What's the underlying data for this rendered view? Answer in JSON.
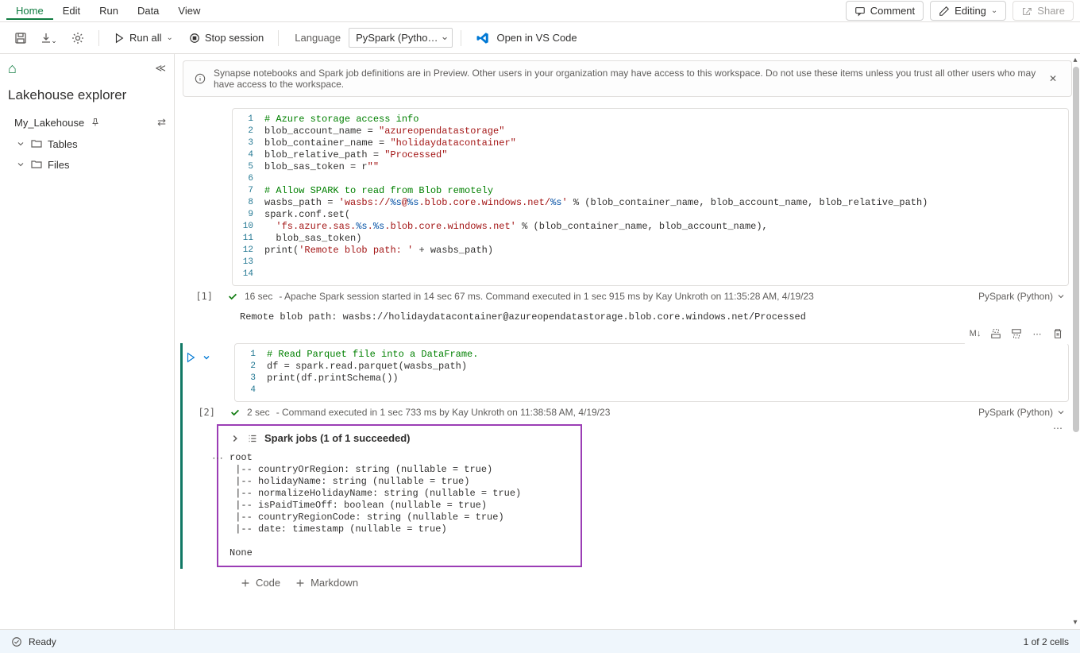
{
  "menubar": {
    "items": [
      "Home",
      "Edit",
      "Run",
      "Data",
      "View"
    ],
    "active_index": 0,
    "comment": "Comment",
    "editing": "Editing",
    "share": "Share"
  },
  "toolbar": {
    "run_all": "Run all",
    "stop_session": "Stop session",
    "language_label": "Language",
    "language_value": "PySpark (Pytho…",
    "open_vscode": "Open in VS Code"
  },
  "sidebar": {
    "title": "Lakehouse explorer",
    "lakehouse_name": "My_Lakehouse",
    "tree": {
      "tables": "Tables",
      "files": "Files"
    }
  },
  "banner": {
    "text": "Synapse notebooks and Spark job definitions are in Preview. Other users in your organization may have access to this workspace. Do not use these items unless you trust all other users who may have access to the workspace."
  },
  "cells": [
    {
      "index": "[1]",
      "lines_count": 13,
      "code_raw": "# Azure storage access info\nblob_account_name = \"azureopendatastorage\"\nblob_container_name = \"holidaydatacontainer\"\nblob_relative_path = \"Processed\"\nblob_sas_token = r\"\"\n\n# Allow SPARK to read from Blob remotely\nwasbs_path = 'wasbs://%s@%s.blob.core.windows.net/%s' % (blob_container_name, blob_account_name, blob_relative_path)\nspark.conf.set(\n  'fs.azure.sas.%s.%s.blob.core.windows.net' % (blob_container_name, blob_account_name),\n  blob_sas_token)\nprint('Remote blob path: ' + wasbs_path)",
      "status_time": "16 sec",
      "status_text": "- Apache Spark session started in 14 sec 67 ms. Command executed in 1 sec 915 ms by Kay Unkroth on 11:35:28 AM, 4/19/23",
      "lang": "PySpark (Python)",
      "output": "Remote blob path: wasbs://holidaydatacontainer@azureopendatastorage.blob.core.windows.net/Processed"
    },
    {
      "index": "[2]",
      "lines_count": 4,
      "code_raw": "# Read Parquet file into a DataFrame.\ndf = spark.read.parquet(wasbs_path)\nprint(df.printSchema())",
      "status_time": "2 sec",
      "status_text": "- Command executed in 1 sec 733 ms by Kay Unkroth on 11:38:58 AM, 4/19/23",
      "lang": "PySpark (Python)",
      "spark_jobs": "Spark jobs (1 of 1 succeeded)",
      "schema_output": "root\n |-- countryOrRegion: string (nullable = true)\n |-- holidayName: string (nullable = true)\n |-- normalizeHolidayName: string (nullable = true)\n |-- isPaidTimeOff: boolean (nullable = true)\n |-- countryRegionCode: string (nullable = true)\n |-- date: timestamp (nullable = true)\n\nNone"
    }
  ],
  "cell_toolbar": {
    "md_label": "M↓"
  },
  "add_cell": {
    "code": "Code",
    "markdown": "Markdown"
  },
  "statusbar": {
    "ready": "Ready",
    "cells": "1 of 2 cells"
  }
}
